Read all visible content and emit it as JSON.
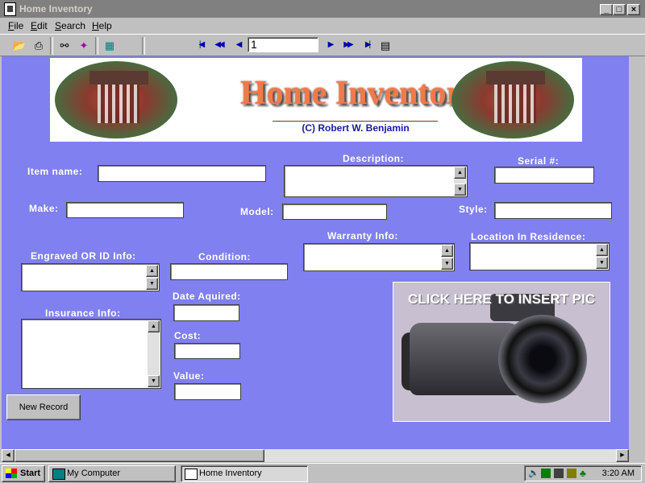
{
  "window": {
    "title": "Home Inventory"
  },
  "menu": [
    {
      "label": "File"
    },
    {
      "label": "Edit"
    },
    {
      "label": "Search"
    },
    {
      "label": "Help"
    }
  ],
  "toolbar": {
    "record_number": "1"
  },
  "banner": {
    "title": "Home Inventory",
    "copyright": "(C) Robert W. Benjamin"
  },
  "form": {
    "item_name_label": "Item name:",
    "description_label": "Description:",
    "serial_label": "Serial #:",
    "make_label": "Make:",
    "model_label": "Model:",
    "style_label": "Style:",
    "engraved_label": "Engraved OR ID Info:",
    "condition_label": "Condition:",
    "warranty_label": "Warranty Info:",
    "location_label": "Location In Residence:",
    "date_label": "Date Aquired:",
    "insurance_label": "Insurance Info:",
    "cost_label": "Cost:",
    "value_label": "Value:",
    "pic_text": "CLICK HERE TO INSERT PIC",
    "new_record_label": "New Record"
  },
  "taskbar": {
    "start_label": "Start",
    "tasks": [
      {
        "label": "My Computer"
      },
      {
        "label": "Home Inventory"
      }
    ],
    "clock": "3:20 AM"
  },
  "colors": {
    "form_background": "#8080f0",
    "titlebar_inactive": "#808080"
  }
}
